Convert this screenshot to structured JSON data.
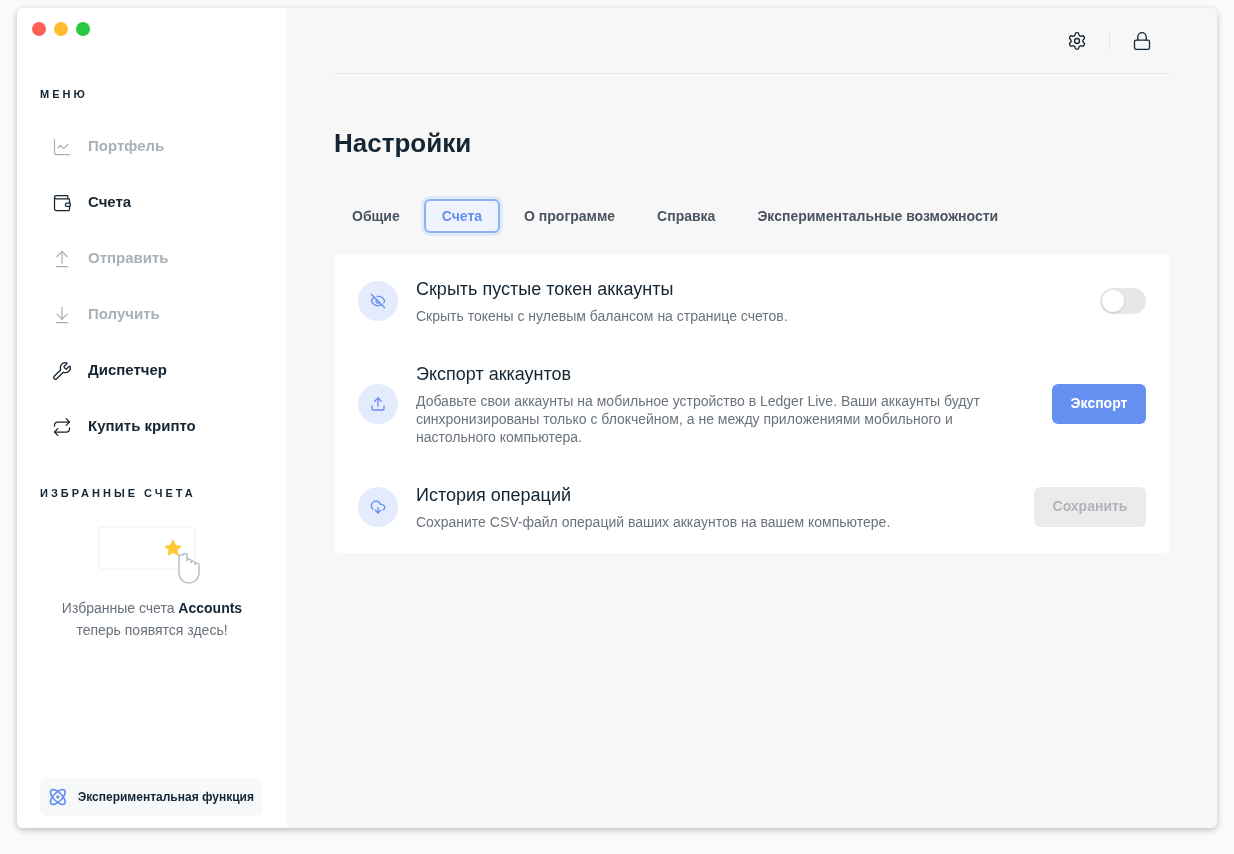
{
  "sidebar": {
    "menu_title": "МЕНЮ",
    "items": [
      {
        "label": "Портфель",
        "kind": "chart",
        "disabled": true
      },
      {
        "label": "Счета",
        "kind": "wallet",
        "disabled": false
      },
      {
        "label": "Отправить",
        "kind": "send",
        "disabled": true
      },
      {
        "label": "Получить",
        "kind": "receive",
        "disabled": true
      },
      {
        "label": "Диспетчер",
        "kind": "tools",
        "disabled": false
      },
      {
        "label": "Купить крипто",
        "kind": "exchange",
        "disabled": false
      }
    ],
    "favorites_title": "ИЗБРАННЫЕ СЧЕТА",
    "favorites_empty": "Избранные счета **Accounts** теперь появятся здесь!",
    "experimental_button": "Экспериментальная функция"
  },
  "page": {
    "title": "Настройки",
    "tabs": [
      {
        "label": "Общие",
        "selected": false
      },
      {
        "label": "Счета",
        "selected": true
      },
      {
        "label": "О программе",
        "selected": false
      },
      {
        "label": "Справка",
        "selected": false
      },
      {
        "label": "Экспериментальные возможности",
        "selected": false
      }
    ],
    "rows": [
      {
        "kind": "toggle",
        "title": "Скрыть пустые токен аккаунты",
        "description": "Скрыть токены с нулевым балансом на странице счетов.",
        "on": false
      },
      {
        "kind": "button",
        "title": "Экспорт аккаунтов",
        "description": "Добавьте свои аккаунты на мобильное устройство в Ledger Live. Ваши аккаунты будут синхронизированы только с блокчейном, а не между приложениями мобильного и настольного компьютера.",
        "button": "Экспорт",
        "disabled": false
      },
      {
        "kind": "button",
        "title": "История операций",
        "description": "Сохраните CSV-файл операций ваших аккаунтов на вашем компьютере.",
        "button": "Сохранить",
        "disabled": true
      }
    ]
  }
}
